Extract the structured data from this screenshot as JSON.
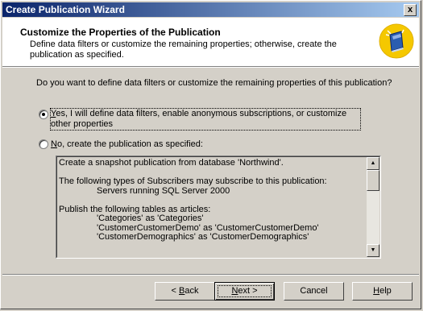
{
  "window": {
    "title": "Create Publication Wizard",
    "close_label": "x"
  },
  "header": {
    "title": "Customize the Properties of the Publication",
    "description": "Define data filters or customize the remaining properties; otherwise, create the publication as specified.",
    "icon": "publication-book-icon"
  },
  "question": "Do you want to define data filters or customize the remaining properties of this publication?",
  "options": [
    {
      "accel": "Y",
      "rest": "es, I will define data filters, enable anonymous subscriptions, or customize other properties",
      "selected": true
    },
    {
      "accel": "N",
      "rest": "o, create the publication as specified:",
      "selected": false
    }
  ],
  "summary_lines": [
    {
      "text": "Create a snapshot publication from database 'Northwind'.",
      "indent": 0
    },
    {
      "text": "",
      "indent": 0
    },
    {
      "text": "The following types of Subscribers may subscribe to this publication:",
      "indent": 0
    },
    {
      "text": "Servers running SQL Server 2000",
      "indent": 1
    },
    {
      "text": "",
      "indent": 0
    },
    {
      "text": "Publish the following tables as articles:",
      "indent": 0
    },
    {
      "text": "'Categories' as 'Categories'",
      "indent": 1
    },
    {
      "text": "'CustomerCustomerDemo' as 'CustomerCustomerDemo'",
      "indent": 1
    },
    {
      "text": "'CustomerDemographics' as 'CustomerDemographics'",
      "indent": 1
    }
  ],
  "buttons": {
    "back": {
      "prefix": "< ",
      "accel": "B",
      "rest": "ack"
    },
    "next": {
      "accel": "N",
      "rest": "ext >"
    },
    "cancel": "Cancel",
    "help": {
      "accel": "H",
      "rest": "elp"
    }
  }
}
